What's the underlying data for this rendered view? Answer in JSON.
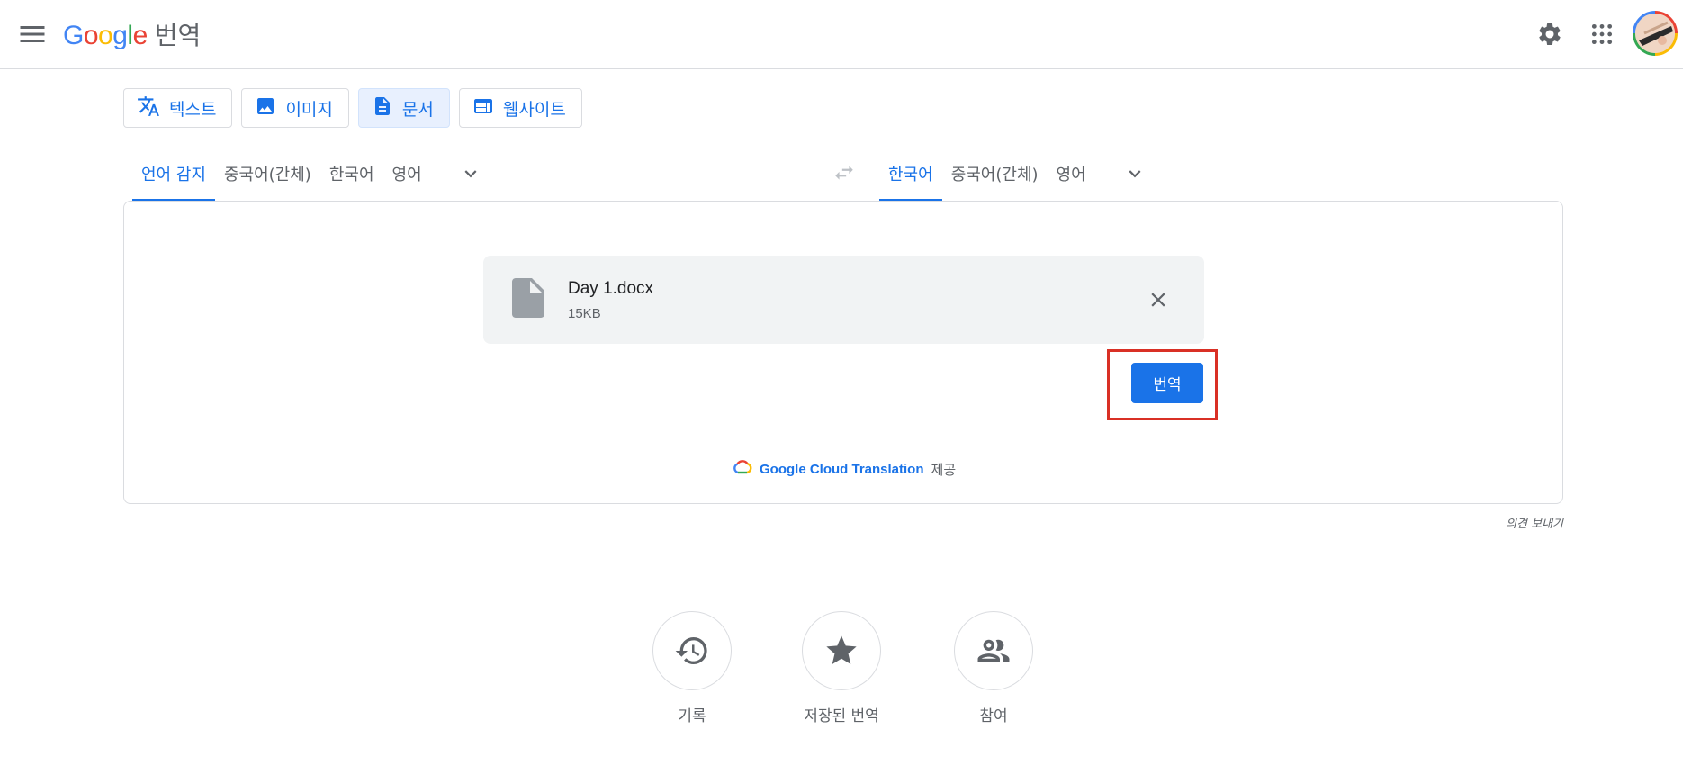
{
  "header": {
    "logo_text": "Google",
    "product_name": "번역",
    "menu_icon": "hamburger-menu-icon",
    "settings_icon": "gear-icon",
    "apps_icon": "apps-grid-icon",
    "account_icon": "avatar"
  },
  "mode_tabs": [
    {
      "label": "텍스트",
      "icon": "translate-icon",
      "active": false
    },
    {
      "label": "이미지",
      "icon": "image-icon",
      "active": false
    },
    {
      "label": "문서",
      "icon": "document-icon",
      "active": true
    },
    {
      "label": "웹사이트",
      "icon": "website-icon",
      "active": false
    }
  ],
  "source_langs": [
    {
      "label": "언어 감지",
      "active": true
    },
    {
      "label": "중국어(간체)",
      "active": false
    },
    {
      "label": "한국어",
      "active": false
    },
    {
      "label": "영어",
      "active": false
    }
  ],
  "target_langs": [
    {
      "label": "한국어",
      "active": true
    },
    {
      "label": "중국어(간체)",
      "active": false
    },
    {
      "label": "영어",
      "active": false
    }
  ],
  "file": {
    "name": "Day 1.docx",
    "size": "15KB"
  },
  "translate_button": "번역",
  "powered_by": {
    "brand": "Google Cloud Translation",
    "suffix": "제공"
  },
  "feedback_link": "의견 보내기",
  "bottom_actions": [
    {
      "label": "기록",
      "icon": "history-icon"
    },
    {
      "label": "저장된 번역",
      "icon": "star-icon"
    },
    {
      "label": "참여",
      "icon": "people-icon"
    }
  ],
  "colors": {
    "accent": "#1a73e8",
    "highlight": "#d93025",
    "border": "#dadce0",
    "icon_gray": "#5f6368"
  }
}
